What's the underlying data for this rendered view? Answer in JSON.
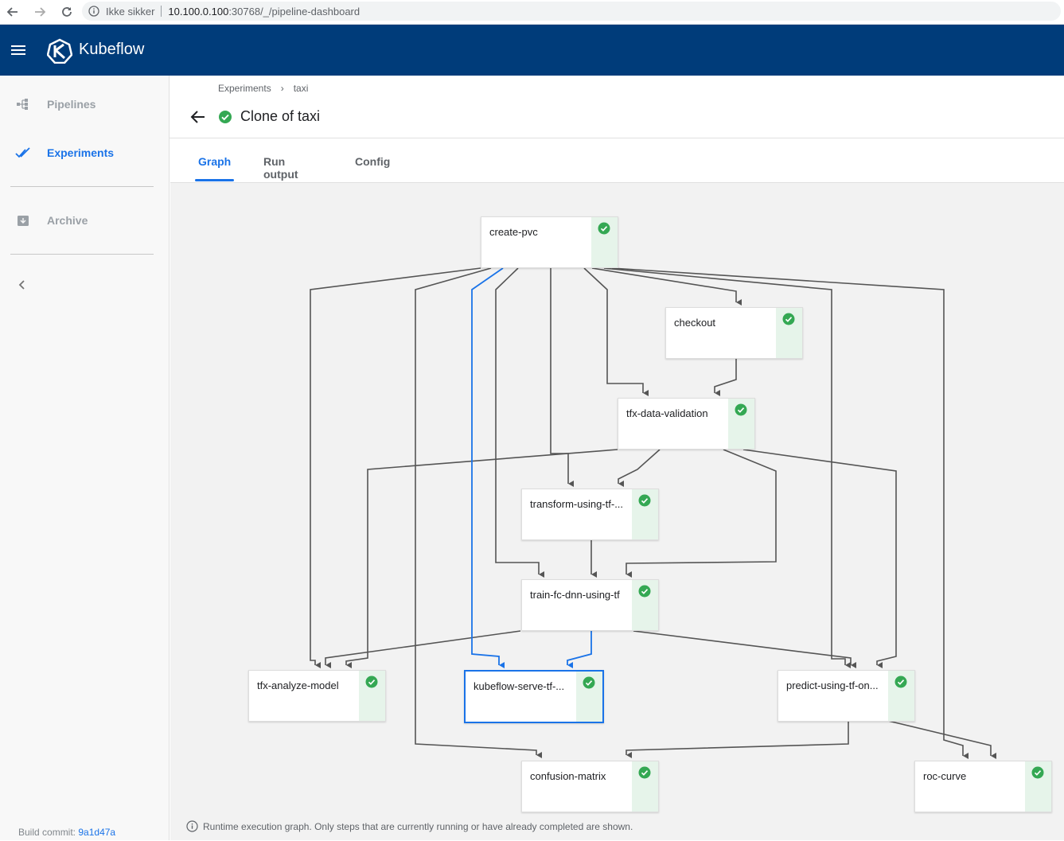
{
  "browser": {
    "security_label": "Ikke sikker",
    "url_host": "10.100.0.100",
    "url_path": ":30768/_/pipeline-dashboard"
  },
  "header": {
    "brand": "Kubeflow",
    "color": "#003c7a"
  },
  "sidebar": {
    "items": [
      {
        "label": "Pipelines",
        "icon": "pipelines-icon",
        "active": false
      },
      {
        "label": "Experiments",
        "icon": "experiments-icon",
        "active": true
      },
      {
        "label": "Archive",
        "icon": "archive-icon",
        "active": false
      }
    ],
    "build_label": "Build commit:",
    "build_commit": "9a1d47a"
  },
  "breadcrumb": {
    "items": [
      "Experiments",
      "taxi"
    ],
    "separator": "›"
  },
  "page": {
    "title": "Clone of taxi",
    "status": "succeeded"
  },
  "tabs": [
    {
      "label": "Graph",
      "active": true
    },
    {
      "label": "Run output",
      "active": false
    },
    {
      "label": "Config",
      "active": false
    }
  ],
  "graph": {
    "nodes": [
      {
        "id": "create-pvc",
        "label": "create-pvc",
        "status": "succeeded"
      },
      {
        "id": "checkout",
        "label": "checkout",
        "status": "succeeded"
      },
      {
        "id": "tfx-data-validation",
        "label": "tfx-data-validation",
        "status": "succeeded"
      },
      {
        "id": "transform",
        "label": "transform-using-tf-...",
        "status": "succeeded"
      },
      {
        "id": "train",
        "label": "train-fc-dnn-using-tf",
        "status": "succeeded"
      },
      {
        "id": "analyze",
        "label": "tfx-analyze-model",
        "status": "succeeded"
      },
      {
        "id": "serve",
        "label": "kubeflow-serve-tf-...",
        "status": "succeeded",
        "selected": true
      },
      {
        "id": "predict",
        "label": "predict-using-tf-on...",
        "status": "succeeded"
      },
      {
        "id": "confusion",
        "label": "confusion-matrix",
        "status": "succeeded"
      },
      {
        "id": "roc",
        "label": "roc-curve",
        "status": "succeeded"
      }
    ],
    "footnote": "Runtime execution graph. Only steps that are currently running or have already completed are shown."
  },
  "colors": {
    "accent": "#1a73e8",
    "success": "#34a853",
    "edge": "#555555"
  }
}
